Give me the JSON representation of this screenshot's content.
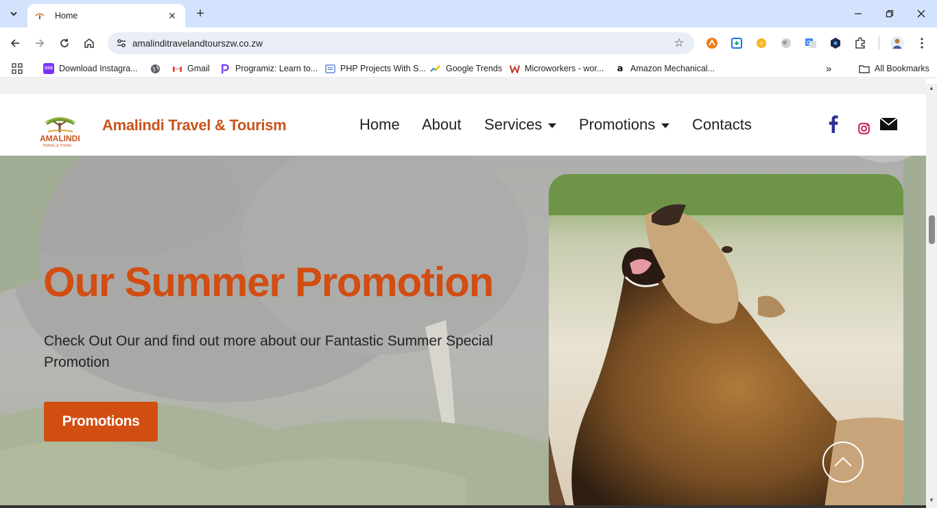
{
  "browser": {
    "tab": {
      "title": "Home"
    },
    "address": {
      "url": "amalinditravelandtourszw.co.zw"
    },
    "bookmarks": [
      {
        "label": "Download Instagra...",
        "icon": "sss-icon"
      },
      {
        "label": "",
        "icon": "globe-icon"
      },
      {
        "label": "Gmail",
        "icon": "gmail-icon"
      },
      {
        "label": "Programiz: Learn to...",
        "icon": "programiz-icon"
      },
      {
        "label": "PHP Projects With S...",
        "icon": "php-projects-icon"
      },
      {
        "label": "Google Trends",
        "icon": "google-trends-icon"
      },
      {
        "label": "Microworkers - wor...",
        "icon": "microworkers-icon"
      },
      {
        "label": "Amazon Mechanical...",
        "icon": "amazon-icon"
      }
    ],
    "all_bookmarks": "All Bookmarks",
    "more_bookmarks": "»"
  },
  "site": {
    "brand": "Amalindi Travel & Tourism",
    "logo_text": "AMALINDI",
    "logo_sub": "TRAVEL & TOURS",
    "nav": [
      {
        "label": "Home"
      },
      {
        "label": "About"
      },
      {
        "label": "Services",
        "dropdown": true
      },
      {
        "label": "Promotions",
        "dropdown": true
      },
      {
        "label": "Contacts"
      }
    ],
    "social": [
      "facebook-icon",
      "instagram-icon",
      "mail-icon"
    ]
  },
  "hero": {
    "title": "Our Summer Promotion",
    "text": "Check Out Our and find out more about our Fantastic Summer Special Promotion",
    "button": "Promotions"
  },
  "colors": {
    "brand": "#c9531b",
    "accent": "#d24d12",
    "tabstrip": "#d3e3fd"
  }
}
